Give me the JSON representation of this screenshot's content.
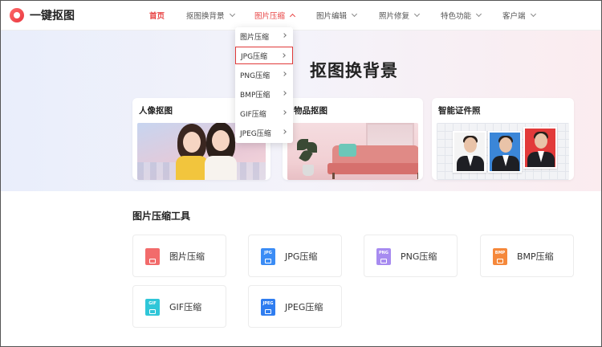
{
  "brand": {
    "name": "一键抠图"
  },
  "nav": {
    "items": [
      {
        "label": "首页"
      },
      {
        "label": "抠图换背景"
      },
      {
        "label": "图片压缩"
      },
      {
        "label": "图片编辑"
      },
      {
        "label": "照片修复"
      },
      {
        "label": "特色功能"
      },
      {
        "label": "客户端"
      }
    ]
  },
  "dropdown": {
    "items": [
      {
        "label": "图片压缩"
      },
      {
        "label": "JPG压缩",
        "selected": true
      },
      {
        "label": "PNG压缩"
      },
      {
        "label": "BMP压缩"
      },
      {
        "label": "GIF压缩"
      },
      {
        "label": "JPEG压缩"
      }
    ]
  },
  "hero": {
    "title": "抠图换背景",
    "cards": [
      {
        "title": "人像抠图"
      },
      {
        "title": "物品抠图"
      },
      {
        "title": "智能证件照"
      }
    ]
  },
  "tools": {
    "title": "图片压缩工具",
    "items": [
      {
        "label": "图片压缩",
        "icon": "image-compress-icon",
        "color": "#f26b6b",
        "tag": ""
      },
      {
        "label": "JPG压缩",
        "icon": "jpg-file-icon",
        "color": "#3b8cf5",
        "tag": "JPG"
      },
      {
        "label": "PNG压缩",
        "icon": "png-file-icon",
        "color": "#a78bf0",
        "tag": "PNG"
      },
      {
        "label": "BMP压缩",
        "icon": "bmp-file-icon",
        "color": "#f5883b",
        "tag": "BMP"
      },
      {
        "label": "GIF压缩",
        "icon": "gif-file-icon",
        "color": "#2fc6d8",
        "tag": "GIF"
      },
      {
        "label": "JPEG压缩",
        "icon": "jpeg-file-icon",
        "color": "#2f7df0",
        "tag": "JPEG"
      }
    ]
  },
  "colors": {
    "accent": "#e84545",
    "selected_border": "#e03a3a"
  }
}
